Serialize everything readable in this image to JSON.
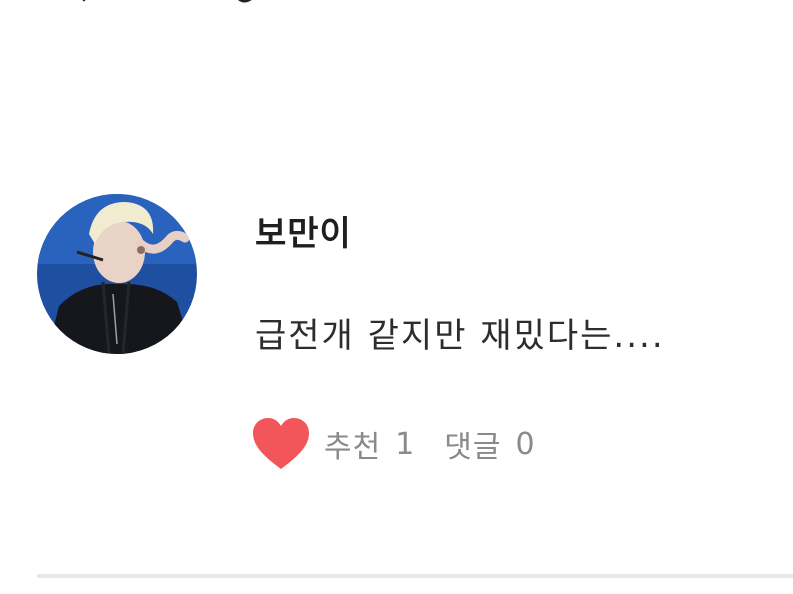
{
  "header": {
    "back_icon": "chevron-left-icon",
    "title_fragment": ""
  },
  "comment": {
    "author": "보만이",
    "text": "급전개 같지만 재밌다는....",
    "recommend_label": "추천",
    "recommend_count": "1",
    "comments_label": "댓글",
    "comments_count": "0",
    "heart_icon": "heart-icon",
    "heart_color": "#f2555a"
  },
  "colors": {
    "background": "#ffffff",
    "text": "#2b2b2b",
    "muted_text": "#8a8a8a",
    "divider": "#e6e8ea",
    "avatar_bg": "#1e4fa0"
  }
}
